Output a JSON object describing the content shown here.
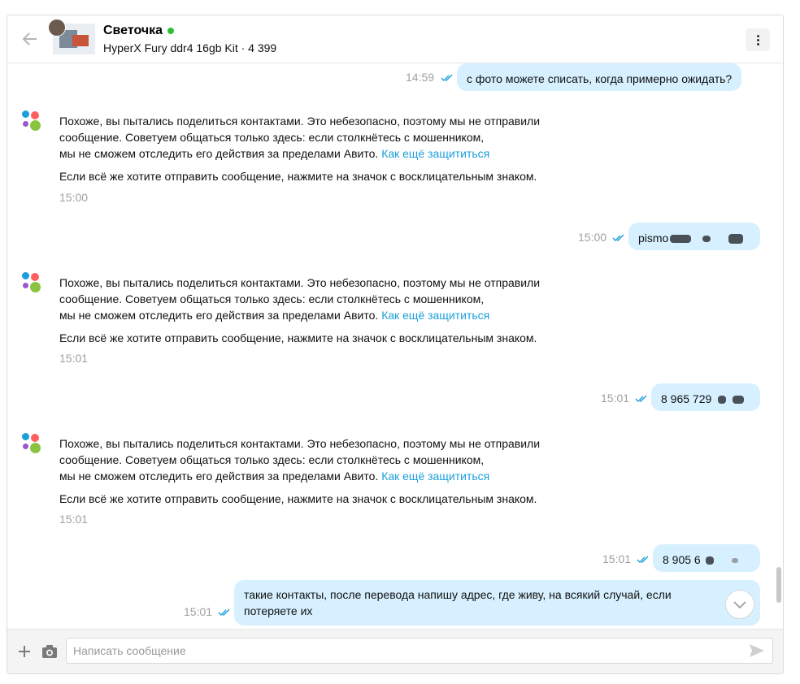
{
  "header": {
    "name": "Светочка",
    "subtitle": "HyperX Fury ddr4 16gb Kit · 4 399 ",
    "currency_symbol": "",
    "online_color": "#2fbf3a"
  },
  "messages": [
    {
      "type": "out",
      "text": "с фото можете списать, когда примерно ожидать?",
      "time": "14:59"
    },
    {
      "type": "system",
      "line1": "Похоже, вы пытались поделиться контактами. Это небезопасно, поэтому мы не отправили",
      "line2": "сообщение. Советуем общаться только здесь: если столкнётесь с мошенником,",
      "line3": "мы не сможем отследить его действия за пределами Авито.",
      "link": "Как ещё защититься",
      "line4": "Если всё же хотите отправить сообщение, нажмите на значок с восклицательным знаком.",
      "time": "15:00"
    },
    {
      "type": "out",
      "text": "pismo",
      "time": "15:00"
    },
    {
      "type": "system",
      "line1": "Похоже, вы пытались поделиться контактами. Это небезопасно, поэтому мы не отправили",
      "line2": "сообщение. Советуем общаться только здесь: если столкнётесь с мошенником,",
      "line3": "мы не сможем отследить его действия за пределами Авито.",
      "link": "Как ещё защититься",
      "line4": "Если всё же хотите отправить сообщение, нажмите на значок с восклицательным знаком.",
      "time": "15:01"
    },
    {
      "type": "out",
      "text": "8 965 729",
      "time": "15:01"
    },
    {
      "type": "system",
      "line1": "Похоже, вы пытались поделиться контактами. Это небезопасно, поэтому мы не отправили",
      "line2": "сообщение. Советуем общаться только здесь: если столкнётесь с мошенником,",
      "line3": "мы не сможем отследить его действия за пределами Авито.",
      "link": "Как ещё защититься",
      "line4": "Если всё же хотите отправить сообщение, нажмите на значок с восклицательным знаком.",
      "time": "15:01"
    },
    {
      "type": "out",
      "text": "8 905 6",
      "time": "15:01"
    },
    {
      "type": "out",
      "text1": "такие контакты, после перевода напишу адрес, где живу, на всякий случай, если",
      "text2": "потеряете их",
      "time": "15:01"
    }
  ],
  "composer": {
    "placeholder": "Написать сообщение"
  },
  "colors": {
    "bubble_out": "#d6f0ff",
    "link": "#1a9fdb",
    "ticks": "#1a9fdb"
  }
}
